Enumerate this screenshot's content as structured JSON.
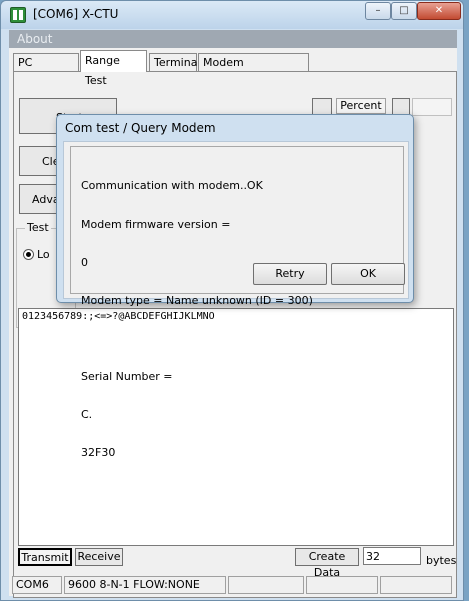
{
  "window": {
    "title": "[COM6] X-CTU"
  },
  "menu": {
    "about": "About"
  },
  "tabs": [
    {
      "label": "PC Settings"
    },
    {
      "label": "Range Test"
    },
    {
      "label": "Terminal"
    },
    {
      "label": "Modem Configuration"
    }
  ],
  "range_test": {
    "start_label": "Start",
    "clear_label": "Cle",
    "advanced_label": "Adva",
    "percent_label": "Percent",
    "test_group_label": "Test",
    "loop_label": "Lo",
    "loop_selected": true
  },
  "terminal": {
    "content": "0123456789:;<=>?@ABCDEFGHIJKLMNO",
    "transmit_label": "Transmit",
    "receive_label": "Receive",
    "create_data_label": "Create Data",
    "bytes_value": "32",
    "bytes_label": "bytes"
  },
  "statusbar": {
    "port": "COM6",
    "settings": "9600 8-N-1  FLOW:NONE"
  },
  "dialog": {
    "title": "Com test / Query Modem",
    "lines": [
      "Communication with modem..OK",
      "Modem firmware version =",
      "0",
      "Modem type = Name unknown (ID = 300)",
      "",
      "Serial Number =",
      "C.",
      "32F30"
    ],
    "retry_label": "Retry",
    "ok_label": "OK"
  }
}
